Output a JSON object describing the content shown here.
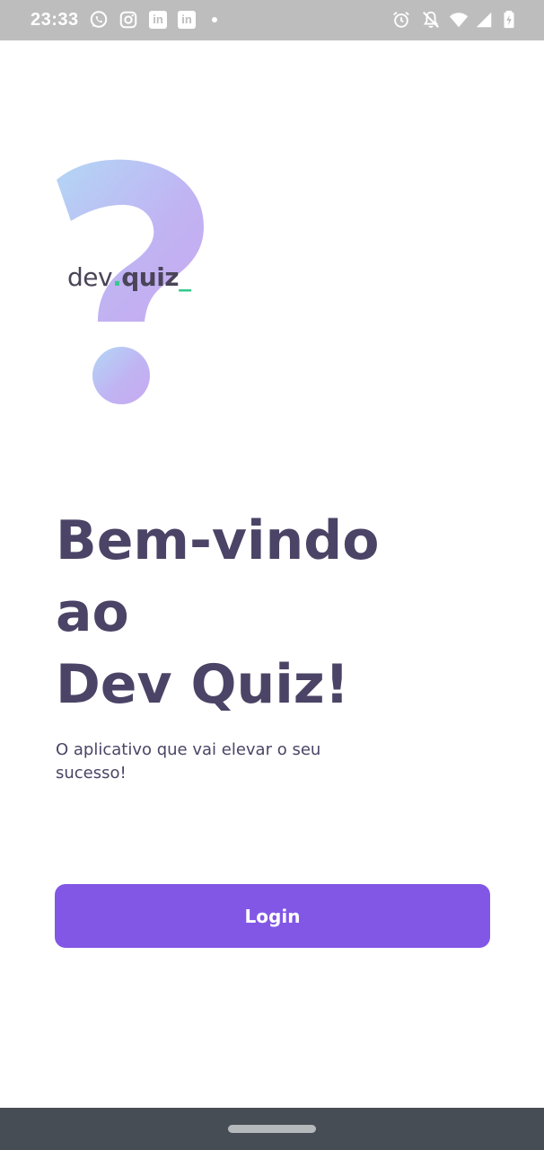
{
  "status_bar": {
    "time": "23:33",
    "left_icons": [
      "whatsapp-icon",
      "instagram-icon",
      "linkedin-icon",
      "linkedin-icon",
      "notification-dot"
    ],
    "right_icons": [
      "alarm-icon",
      "notifications-off-icon",
      "wifi-icon",
      "signal-icon",
      "battery-charging-icon"
    ],
    "linkedin_glyph": "in",
    "background": "#bdbdbd"
  },
  "logo": {
    "text_dev": "dev",
    "text_dot": ".",
    "text_quiz": "quiz",
    "text_underscore": "_",
    "accent_green": "#36c98f"
  },
  "welcome": {
    "line1": "Bem-vindo",
    "line2": "ao",
    "line3": "Dev Quiz!",
    "subtitle": "O aplicativo que vai elevar o seu sucesso!",
    "text_color": "#4b4466"
  },
  "login_button": {
    "label": "Login",
    "color": "#8257e5"
  },
  "nav_bar": {
    "background": "#474d54"
  }
}
